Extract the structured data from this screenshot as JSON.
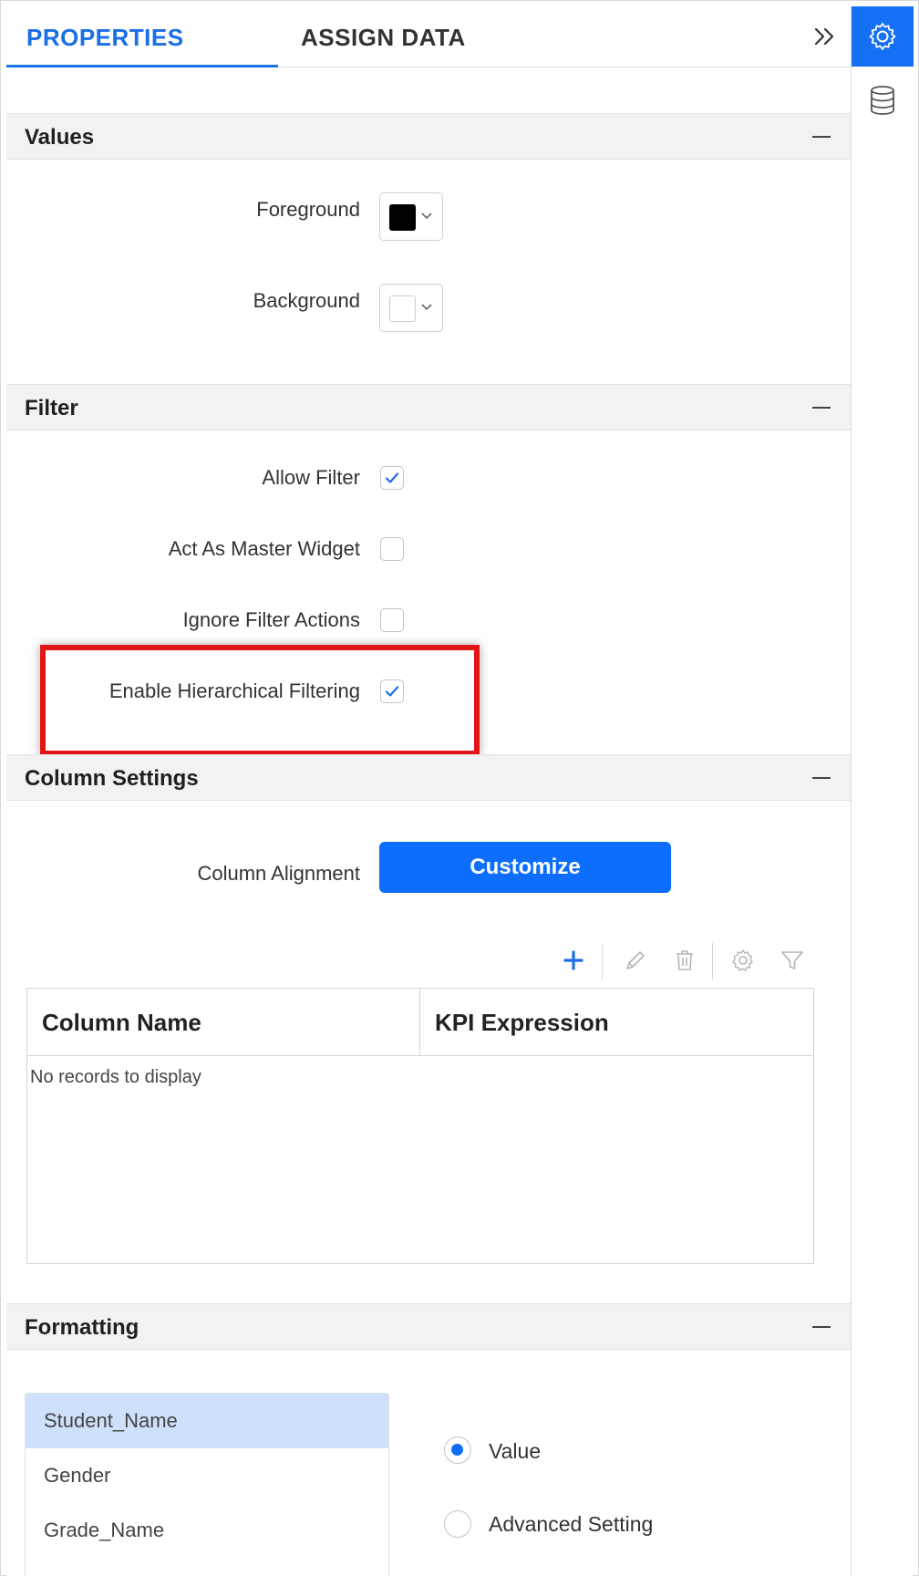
{
  "tabs": {
    "properties": "PROPERTIES",
    "assign_data": "ASSIGN DATA"
  },
  "sections": {
    "values": {
      "title": "Values",
      "foreground_label": "Foreground",
      "background_label": "Background",
      "foreground_color": "#000000",
      "background_color": "#ffffff"
    },
    "filter": {
      "title": "Filter",
      "items": [
        {
          "label": "Allow Filter",
          "checked": true
        },
        {
          "label": "Act As Master Widget",
          "checked": false
        },
        {
          "label": "Ignore Filter Actions",
          "checked": false
        },
        {
          "label": "Enable Hierarchical Filtering",
          "checked": true
        }
      ]
    },
    "column_settings": {
      "title": "Column Settings",
      "alignment_label": "Column Alignment",
      "customize_label": "Customize",
      "grid": {
        "columns": [
          "Column Name",
          "KPI Expression"
        ],
        "empty_text": "No records to display"
      }
    },
    "formatting": {
      "title": "Formatting",
      "fields": [
        "Student_Name",
        "Gender",
        "Grade_Name"
      ],
      "selected_field": "Student_Name",
      "options": [
        {
          "label": "Value",
          "selected": true
        },
        {
          "label": "Advanced Setting",
          "selected": false
        }
      ]
    }
  },
  "colors": {
    "accent": "#1a73e8",
    "button": "#0d6efd",
    "highlight": "#e21515"
  }
}
